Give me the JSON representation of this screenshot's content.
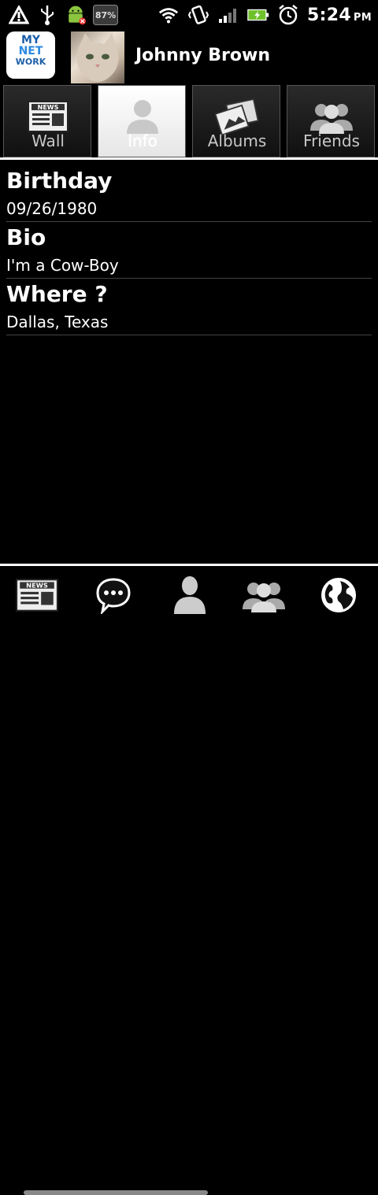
{
  "status_bar": {
    "battery_percent": "87%",
    "time": "5:24",
    "ampm": "PM",
    "icons": [
      "warning-icon",
      "usb-icon",
      "android-icon",
      "wifi-icon",
      "vibrate-icon",
      "signal-icon",
      "battery-icon",
      "alarm-icon"
    ]
  },
  "header": {
    "logo_lines": [
      "MY",
      "NET",
      "WORK"
    ],
    "user_name": "Johnny Brown"
  },
  "tabs": [
    {
      "label": "Wall",
      "icon": "news-icon",
      "active": false
    },
    {
      "label": "Info",
      "icon": "person-icon",
      "active": true
    },
    {
      "label": "Albums",
      "icon": "photos-icon",
      "active": false
    },
    {
      "label": "Friends",
      "icon": "people-icon",
      "active": false
    }
  ],
  "info": [
    {
      "title": "Birthday",
      "value": "09/26/1980"
    },
    {
      "title": "Bio",
      "value": "I'm a Cow-Boy"
    },
    {
      "title": "Where ?",
      "value": "Dallas, Texas"
    }
  ],
  "bottom_nav": [
    "news-icon",
    "chat-icon",
    "person-icon",
    "people-icon",
    "globe-icon"
  ],
  "colors": {
    "accent": "#2a7dc7",
    "background": "#000000"
  }
}
